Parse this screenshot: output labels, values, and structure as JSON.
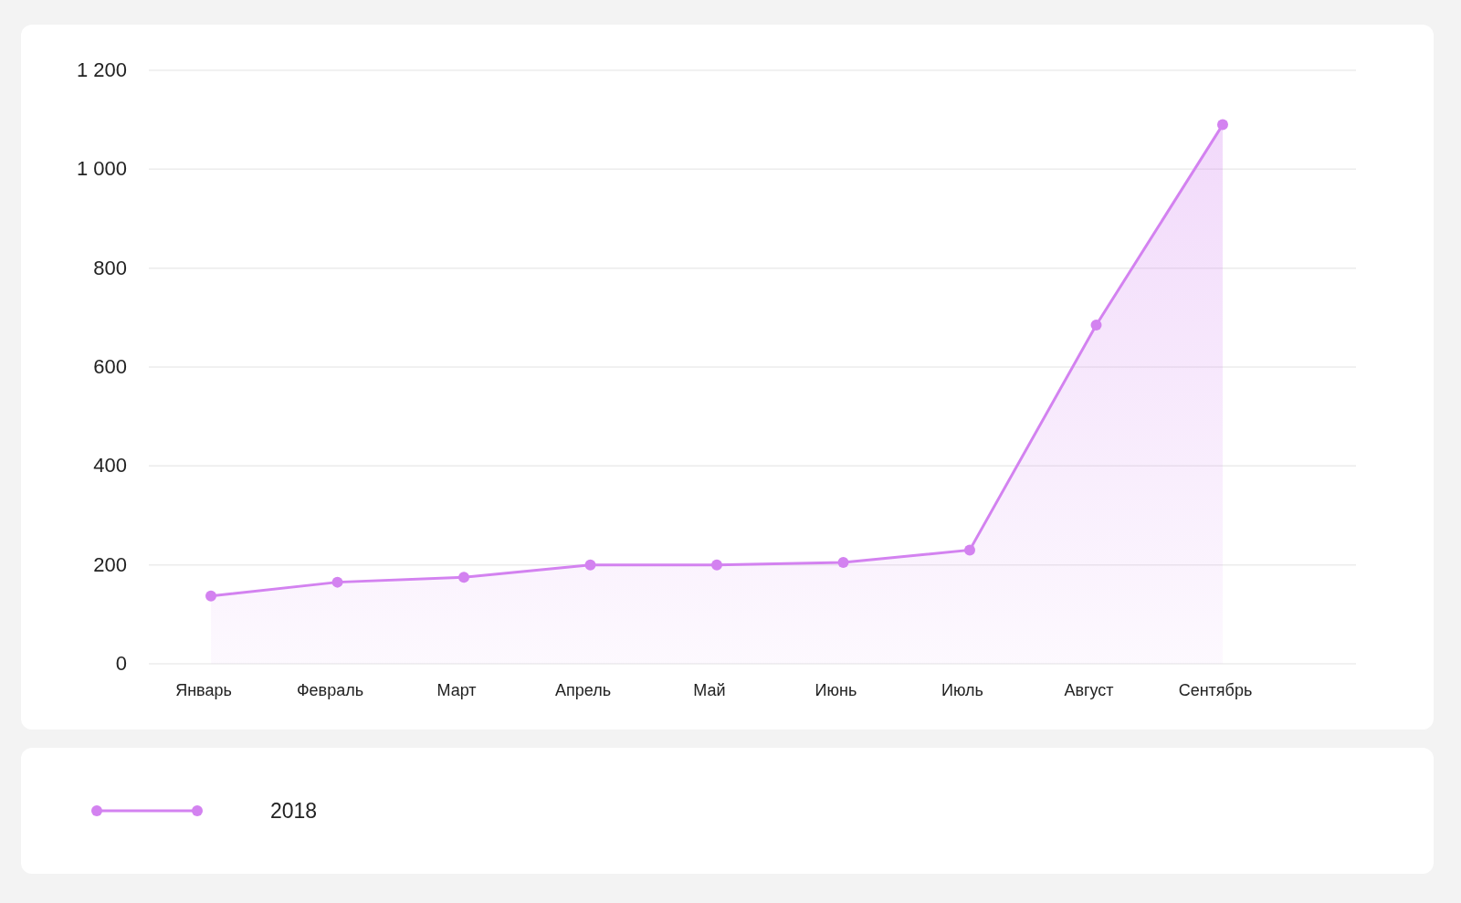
{
  "chart": {
    "chart_data": {
      "type": "area",
      "categories": [
        "Январь",
        "Февраль",
        "Март",
        "Апрель",
        "Май",
        "Июнь",
        "Июль",
        "Август",
        "Сентябрь"
      ],
      "series": [
        {
          "name": "2018",
          "color": "#d382f0",
          "values": [
            137,
            165,
            175,
            200,
            200,
            205,
            230,
            685,
            1090
          ]
        }
      ],
      "ylim": [
        0,
        1200
      ],
      "grid": true,
      "yticks": [
        {
          "value": 0,
          "label": "0"
        },
        {
          "value": 200,
          "label": "200"
        },
        {
          "value": 400,
          "label": "400"
        },
        {
          "value": 600,
          "label": "600"
        },
        {
          "value": 800,
          "label": "800"
        },
        {
          "value": 1000,
          "label": "1 000"
        },
        {
          "value": 1200,
          "label": "1 200"
        }
      ]
    }
  }
}
